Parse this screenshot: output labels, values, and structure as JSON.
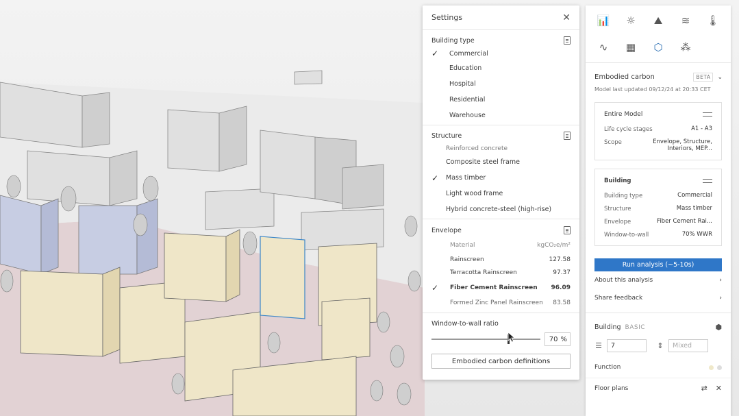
{
  "settings": {
    "title": "Settings",
    "building_type": {
      "title": "Building type",
      "options": [
        {
          "label": "Commercial",
          "selected": true
        },
        {
          "label": "Education",
          "selected": false
        },
        {
          "label": "Hospital",
          "selected": false
        },
        {
          "label": "Residential",
          "selected": false
        },
        {
          "label": "Warehouse",
          "selected": false
        }
      ]
    },
    "structure": {
      "title": "Structure",
      "options": [
        {
          "label": "Reinforced concrete",
          "selected": false
        },
        {
          "label": "Composite steel frame",
          "selected": false
        },
        {
          "label": "Mass timber",
          "selected": true
        },
        {
          "label": "Light wood frame",
          "selected": false
        },
        {
          "label": "Hybrid concrete-steel (high-rise)",
          "selected": false
        }
      ]
    },
    "envelope": {
      "title": "Envelope",
      "col_material": "Material",
      "col_unit": "kgCO₂e/m²",
      "rows": [
        {
          "label": "Rainscreen",
          "value": "127.58",
          "selected": false
        },
        {
          "label": "Terracotta Rainscreen",
          "value": "97.37",
          "selected": false
        },
        {
          "label": "Fiber Cement Rainscreen",
          "value": "96.09",
          "selected": true
        },
        {
          "label": "Formed Zinc Panel Rainscreen",
          "value": "83.58",
          "selected": false
        }
      ]
    },
    "wwr": {
      "label": "Window-to-wall ratio",
      "value": "70",
      "unit": "%",
      "fraction": 0.7
    },
    "definitions_button": "Embodied carbon definitions"
  },
  "panel": {
    "toolbar_icons": [
      "bar-chart-icon",
      "sun-icon",
      "daylight-icon",
      "wind-icon",
      "thermometer-icon",
      "noise-icon",
      "solar-panel-icon",
      "embodied-carbon-icon",
      "cluster-icon"
    ],
    "embodied": {
      "title": "Embodied carbon",
      "badge": "BETA",
      "updated": "Model last updated 09/12/24 at 20:33 CET"
    },
    "entire_model": {
      "title": "Entire Model",
      "rows": [
        {
          "k": "Life cycle stages",
          "v": "A1 - A3"
        },
        {
          "k": "Scope",
          "v": "Envelope, Structure, Interiors, MEP..."
        }
      ]
    },
    "building_card": {
      "title": "Building",
      "rows": [
        {
          "k": "Building type",
          "v": "Commercial"
        },
        {
          "k": "Structure",
          "v": "Mass timber"
        },
        {
          "k": "Envelope",
          "v": "Fiber Cement Rai..."
        },
        {
          "k": "Window-to-wall",
          "v": "70% WWR"
        }
      ]
    },
    "run_button": "Run analysis (~5-10s)",
    "about": "About this analysis",
    "feedback": "Share feedback",
    "building": {
      "title": "Building",
      "subtitle": "BASIC",
      "floors": "7",
      "height_placeholder": "Mixed"
    },
    "function_label": "Function",
    "floor_plans_label": "Floor plans"
  }
}
